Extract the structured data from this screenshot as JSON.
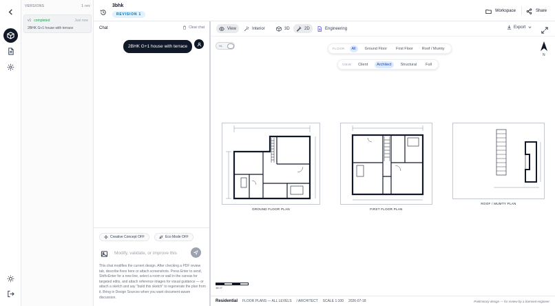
{
  "rail": {
    "icons": [
      "back-arrow-icon",
      "cube-icon",
      "document-icon",
      "settings-icon",
      "sun-icon",
      "logout-icon"
    ]
  },
  "versions": {
    "heading": "VERSIONS",
    "count": "1 rev",
    "items": [
      {
        "tag": "v1",
        "status": "completed",
        "time": "Just now",
        "description": "2BHK G+1 house with terrace"
      }
    ]
  },
  "header": {
    "project_name": "3bhk",
    "revision_badge": "REVISION 1",
    "workspace_label": "Workspace",
    "share_label": "Share"
  },
  "chat": {
    "title": "Chat",
    "clear_label": "Clear chat",
    "messages": [
      {
        "role": "user",
        "text": "2BHK G+1 house with terrace"
      }
    ],
    "creative_toggle": "Creative Concept OFF",
    "eco_toggle": "Eco Mode OFF",
    "input_placeholder": "Modify, validate, or improve this",
    "help_text": "This chat modifies the current design. After checking a PDF review tab, describe fixes here or attach screenshots. Press Enter to send, Shift+Enter for a new line, select a room or wall in the canvas for targeted edits, and attach reference images for visual guidance — or attach a sketch and say \"build this sketch\" to regenerate the plan from it. Bring in Design Sources when you want document-aware discussion."
  },
  "toolbar": {
    "view_label": "View",
    "interior_label": "Interior",
    "view3d_label": "3D",
    "view2d_label": "2D",
    "engineering_label": "Engineering",
    "export_label": "Export",
    "active_mode": "2D"
  },
  "canvas": {
    "mini_toggle_label": "HL",
    "floor_filter": {
      "label": "FLOOR",
      "options": [
        "All",
        "Ground Floor",
        "First Floor",
        "Roof / Mumty"
      ],
      "selected": "All"
    },
    "view_filter": {
      "label": "VIEW",
      "options": [
        "Client",
        "Architect",
        "Structural",
        "Full"
      ],
      "selected": "Architect"
    },
    "north_label": "N",
    "plans": [
      {
        "title": "GROUND FLOOR PLAN"
      },
      {
        "title": "FIRST FLOOR PLAN"
      },
      {
        "title": "ROOF / MUMTY PLAN"
      }
    ],
    "scale_label": "16'-0\""
  },
  "statusbar": {
    "type": "Residential",
    "levels": "FLOOR PLANS — ALL LEVELS",
    "discipline": "/ ARCHITECT",
    "scale": "SCALE 1:100",
    "date": "2026-07-18",
    "disclaimer": "Preliminary design — for review by a licensed engineer."
  },
  "colors": {
    "accent": "#111827",
    "badge_bg": "#e0f2fe",
    "badge_text": "#0369a1",
    "selected_chip": "#dbeafe",
    "status_ok": "#16a34a"
  }
}
